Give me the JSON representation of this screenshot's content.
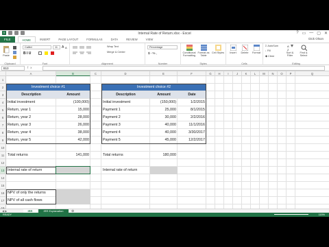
{
  "window": {
    "title": "Internal Rate of Return.xlsx - Excel",
    "controls": [
      "?",
      "▭",
      "—",
      "▢",
      "✕"
    ],
    "user": "Dick Olson"
  },
  "tabs": [
    "FILE",
    "HOME",
    "INSERT",
    "PAGE LAYOUT",
    "FORMULAS",
    "DATA",
    "REVIEW",
    "VIEW"
  ],
  "ribbon": {
    "paste_label": "Paste",
    "font_name": "Calibri",
    "font_size": "11",
    "font_glyphs": "B I U",
    "wrap_text": "Wrap Text",
    "merge_center": "Merge & Center",
    "number_format": "Percentage",
    "number_symbols": "$ - % ,",
    "conditional_formatting": "Conditional Formatting",
    "format_as_table": "Format as Table",
    "cell_styles": "Cell Styles",
    "insert": "Insert",
    "delete": "Delete",
    "format": "Format",
    "autosum": "AutoSum",
    "fill": "Fill",
    "clear": "Clear",
    "sort_filter": "Sort & Filter",
    "find_select": "Find & Select",
    "groups": [
      "Clipboard",
      "Font",
      "Alignment",
      "Number",
      "Styles",
      "Cells",
      "Editing"
    ]
  },
  "formula_bar": {
    "name_box": "B13",
    "fx": "fx",
    "value": ""
  },
  "columns": [
    "A",
    "B",
    "C",
    "D",
    "E",
    "F",
    "G",
    "H",
    "I",
    "J",
    "K",
    "L",
    "M",
    "N",
    "O",
    "P",
    "Q"
  ],
  "rows": [
    "1",
    "2",
    "3",
    "4",
    "5",
    "6",
    "7",
    "8",
    "9",
    "10",
    "11",
    "12",
    "13",
    "14",
    "15",
    "16",
    "17",
    "18"
  ],
  "sheet": {
    "inv1_title": "Investment choice #1",
    "inv2_title": "Investment choice #2",
    "headers1": [
      "Description",
      "Amount"
    ],
    "headers2": [
      "Description",
      "Amount",
      "Date"
    ],
    "table1": [
      [
        "Initial investment",
        "(100,000)"
      ],
      [
        "Return, year 1",
        "15,000"
      ],
      [
        "Return, year 2",
        "28,000"
      ],
      [
        "Return, year 3",
        "26,000"
      ],
      [
        "Return, year 4",
        "38,000"
      ],
      [
        "Return, year 5",
        "42,000"
      ]
    ],
    "table2": [
      [
        "Initial investment",
        "(150,000)",
        "1/2/2015"
      ],
      [
        "Payment 1",
        "25,000",
        "8/1/2015"
      ],
      [
        "Payment 2",
        "30,000",
        "2/2/2016"
      ],
      [
        "Payment 3",
        "40,000",
        "11/1/2016"
      ],
      [
        "Payment 4",
        "40,000",
        "3/30/2017"
      ],
      [
        "Payment 5",
        "45,000",
        "12/2/2017"
      ]
    ],
    "total1_label": "Total returns",
    "total1_value": "141,000",
    "total2_label": "Total returns",
    "total2_value": "180,000",
    "irr1_label": "Internal rate of return",
    "irr2_label": "Internal rate of return",
    "npv_returns_label": "NPV of only the returns",
    "npv_all_label": "NPV of all cash flows"
  },
  "sheet_tabs": [
    "IRR",
    "IRR Explanation"
  ],
  "status": {
    "ready": "READY",
    "zoom": "115%"
  },
  "colors": {
    "accent": "#217346",
    "table_header": "#3a70b5"
  }
}
